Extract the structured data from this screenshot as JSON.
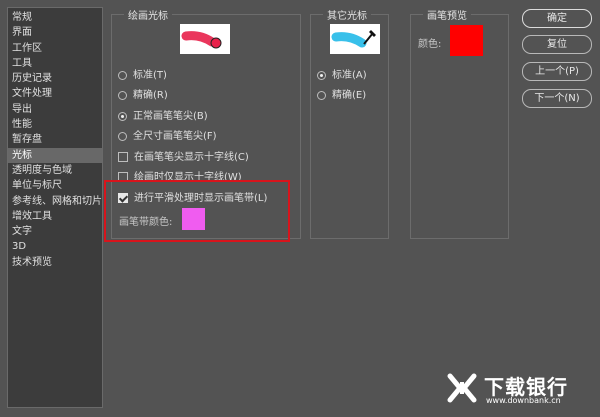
{
  "sidebar": {
    "items": [
      {
        "label": "常规"
      },
      {
        "label": "界面"
      },
      {
        "label": "工作区"
      },
      {
        "label": "工具"
      },
      {
        "label": "历史记录"
      },
      {
        "label": "文件处理"
      },
      {
        "label": "导出"
      },
      {
        "label": "性能"
      },
      {
        "label": "暂存盘"
      },
      {
        "label": "光标",
        "selected": true
      },
      {
        "label": "透明度与色域"
      },
      {
        "label": "单位与标尺"
      },
      {
        "label": "参考线、网格和切片"
      },
      {
        "label": "增效工具"
      },
      {
        "label": "文字"
      },
      {
        "label": "3D"
      },
      {
        "label": "技术预览"
      }
    ]
  },
  "paint_cursor": {
    "title": "绘画光标",
    "options": {
      "standard": "标准(T)",
      "precise": "精确(R)",
      "normal_tip": "正常画笔笔尖(B)",
      "full_tip": "全尺寸画笔笔尖(F)"
    },
    "selected": "normal_tip",
    "checks": {
      "crosshair_in_tip": "在画笔笔尖显示十字线(C)",
      "crosshair_while_painting": "绘画时仅显示十字线(W)",
      "show_leash": "进行平滑处理时显示画笔带(L)"
    },
    "checked": {
      "crosshair_in_tip": false,
      "crosshair_while_painting": false,
      "show_leash": true
    },
    "leash_color_label": "画笔带颜色:",
    "leash_color": "#f05cf0"
  },
  "other_cursor": {
    "title": "其它光标",
    "options": {
      "standard": "标准(A)",
      "precise": "精确(E)"
    },
    "selected": "standard"
  },
  "brush_preview": {
    "title": "画笔预览",
    "color_label": "颜色:",
    "color": "#ff0000"
  },
  "buttons": {
    "ok": "确定",
    "reset": "复位",
    "prev": "上一个(P)",
    "next": "下一个(N)"
  },
  "watermark": {
    "name": "下载银行",
    "url": "www.downbank.cn"
  }
}
